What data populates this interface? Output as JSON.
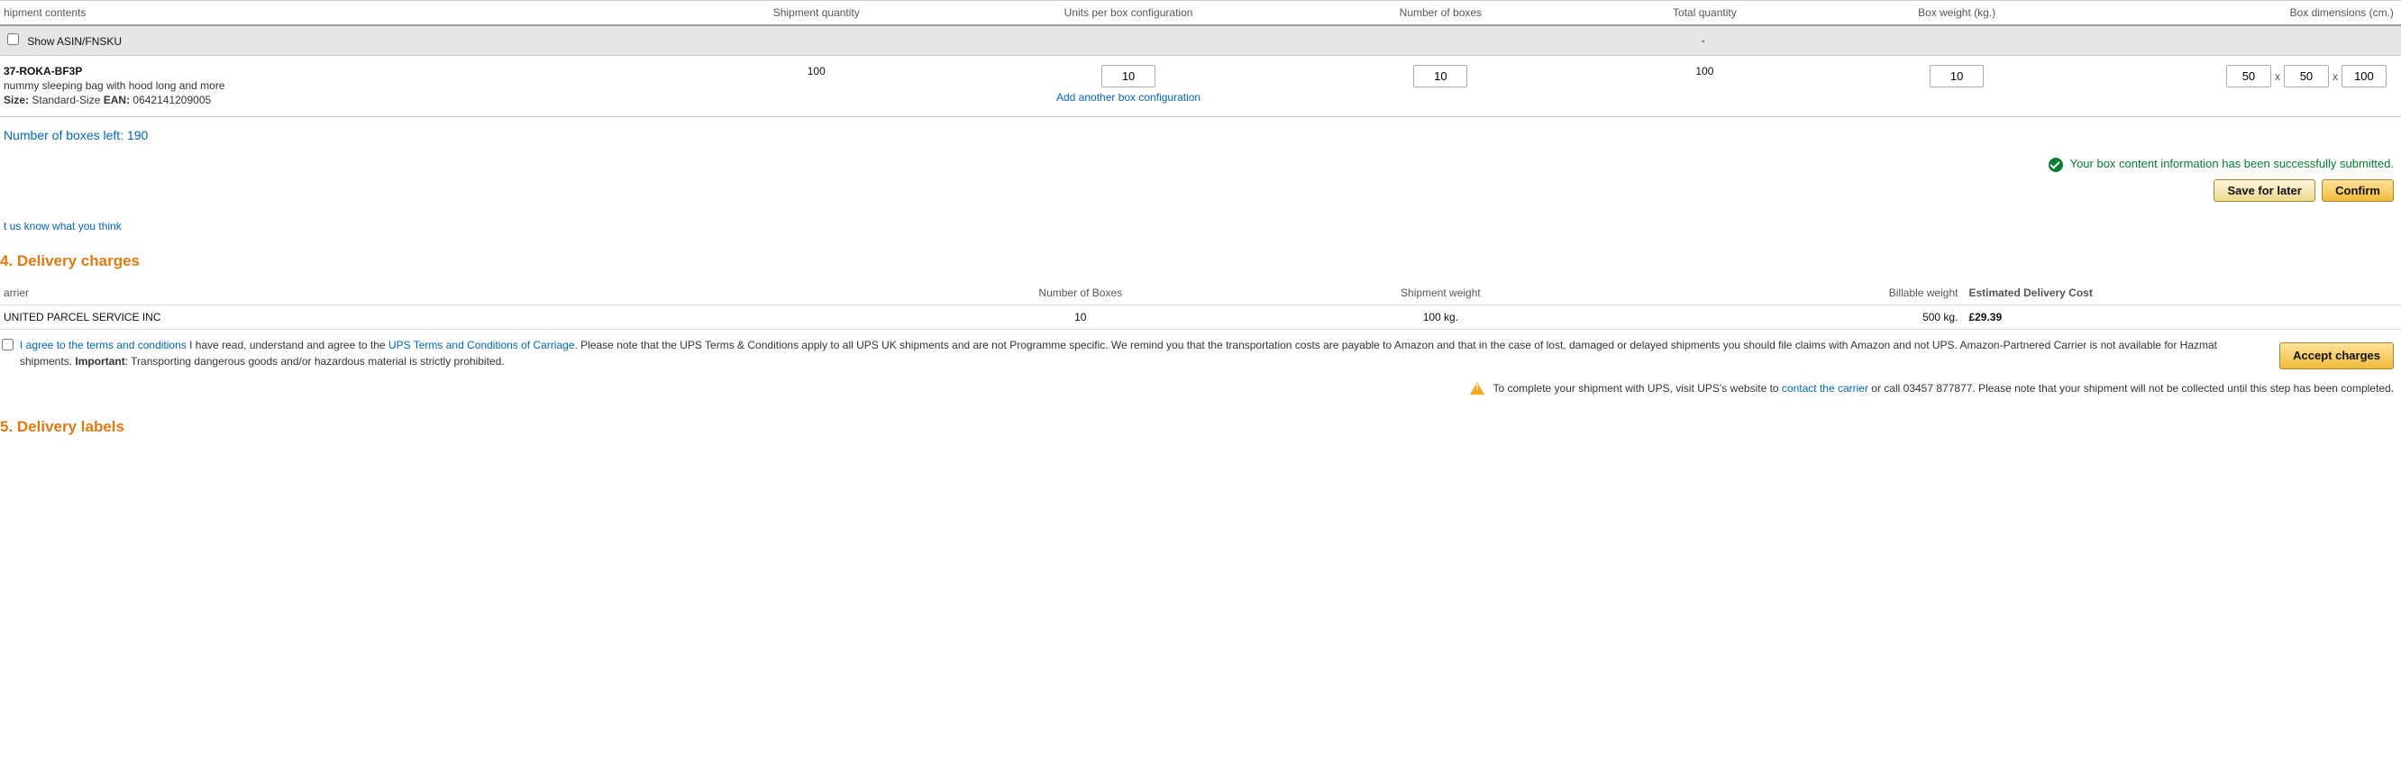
{
  "headers": {
    "contents": "hipment contents",
    "shipqty": "Shipment quantity",
    "unitsper": "Units per box configuration",
    "numboxes": "Number of boxes",
    "totalqty": "Total quantity",
    "weight": "Box weight (kg.)",
    "dims": "Box dimensions (cm.)"
  },
  "asin": {
    "label": "Show ASIN/FNSKU",
    "dash": "-"
  },
  "item": {
    "sku": "37-ROKA-BF3P",
    "desc": "nummy sleeping bag with hood long and more",
    "size_label": "Size:",
    "size_val": " Standard-Size ",
    "ean_label": "EAN:",
    "ean_val": " 0642141209005",
    "shipqty": "100",
    "unitsper": "10",
    "numboxes": "10",
    "totalqty": "100",
    "weight": "10",
    "dim_l": "50",
    "dim_w": "50",
    "dim_h": "100",
    "dim_sep": "x"
  },
  "add_config": "Add another box configuration",
  "boxes_left": "Number of boxes left: 190",
  "success_msg": "Your box content information has been successfully submitted.",
  "btn_save": "Save for later",
  "btn_confirm": "Confirm",
  "feedback": "t us know what you think",
  "section4": "4. Delivery charges",
  "delhdr": {
    "carrier": "arrier",
    "numbox": "Number of Boxes",
    "shipwt": "Shipment weight",
    "billwt": "Billable weight",
    "cost": "Estimated Delivery Cost"
  },
  "delrow": {
    "carrier": "UNITED PARCEL SERVICE INC",
    "numbox": "10",
    "shipwt": "100 kg.",
    "billwt": "500 kg.",
    "cost": "£29.39"
  },
  "terms": {
    "agree_link": "I agree to the terms and conditions",
    "t1": " I have read, understand and agree to the ",
    "ups_link": "UPS Terms and Conditions of Carriage",
    "t2": ". Please note that the UPS Terms & Conditions apply to all UPS UK shipments and are not Programme specific. We remind you that the transportation costs are payable to Amazon and that in the case of lost, damaged or delayed shipments you should file claims with Amazon and not UPS. Amazon-Partnered Carrier is not available for Hazmat shipments. ",
    "imp_label": "Important",
    "t3": ": Transporting dangerous goods and/or hazardous material is strictly prohibited."
  },
  "btn_accept": "Accept charges",
  "warn": {
    "t1": "To complete your shipment with UPS, visit UPS's website to ",
    "contact_link": "contact the carrier",
    "t2": " or call 03457 877877. Please note that your shipment will not be collected until this step has been completed."
  },
  "section5": "5. Delivery labels"
}
